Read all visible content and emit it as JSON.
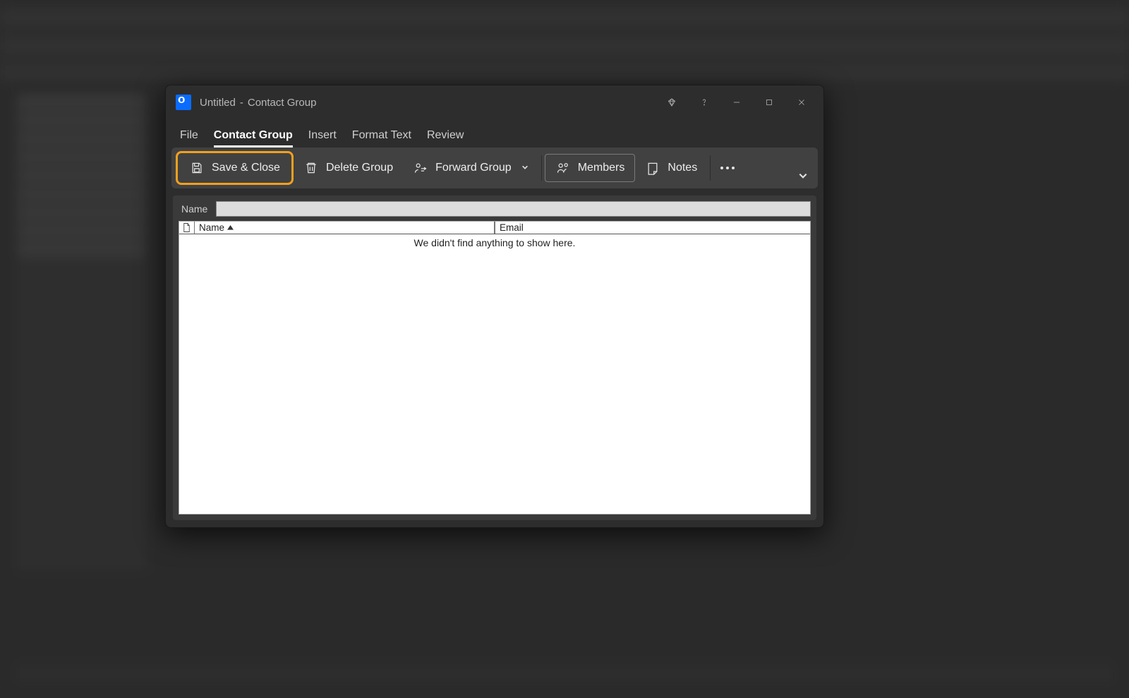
{
  "title": {
    "doc": "Untitled",
    "sep": "-",
    "context": "Contact Group"
  },
  "tabs": {
    "file": "File",
    "contact_group": "Contact Group",
    "insert": "Insert",
    "format_text": "Format Text",
    "review": "Review"
  },
  "ribbon": {
    "save_close": "Save & Close",
    "delete_group": "Delete Group",
    "forward_group": "Forward Group",
    "members": "Members",
    "notes": "Notes"
  },
  "form": {
    "name_label": "Name",
    "name_value": ""
  },
  "columns": {
    "name": "Name",
    "email": "Email"
  },
  "empty_message": "We didn't find anything to show here."
}
